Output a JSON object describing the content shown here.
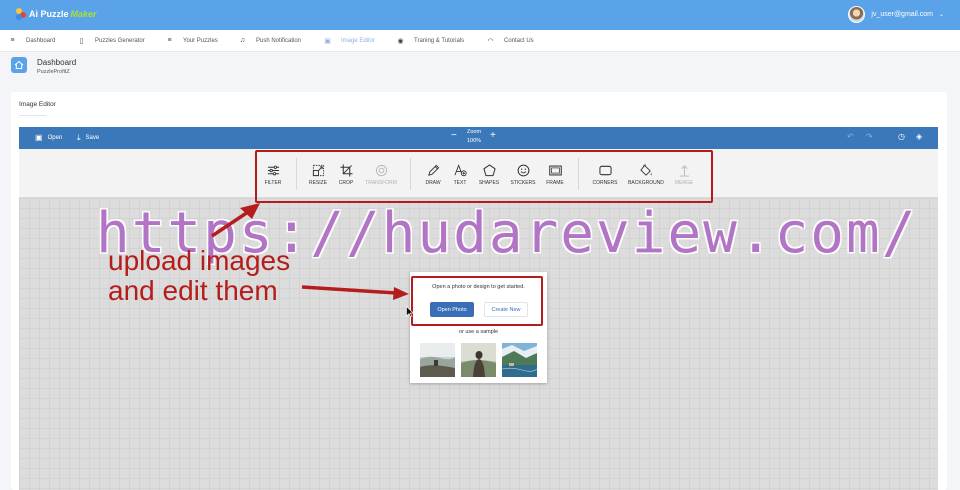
{
  "header": {
    "logo_text": "Ai Puzzle",
    "logo_accent": "Maker",
    "user_email": "jv_user@gmail.com",
    "caret": "⌄"
  },
  "nav": {
    "items": [
      {
        "label": "Dashboard",
        "icon": "menu-icon",
        "glyph": "≡"
      },
      {
        "label": "Puzzles Generator",
        "icon": "tablet-icon",
        "glyph": "▯"
      },
      {
        "label": "Your Puzzles",
        "icon": "list-icon",
        "glyph": "≡"
      },
      {
        "label": "Push Notification",
        "icon": "bell-icon",
        "glyph": "♫"
      },
      {
        "label": "Image Editor",
        "icon": "image-icon",
        "glyph": "▣",
        "active": true
      },
      {
        "label": "Traning & Tutorials",
        "icon": "play-circle-icon",
        "glyph": "◉"
      },
      {
        "label": "Contact Us",
        "icon": "headset-icon",
        "glyph": "◠"
      }
    ]
  },
  "breadcrumb": {
    "title": "Dashboard",
    "subtitle": "PuzzleProfitZ"
  },
  "card": {
    "title": "Image Editor"
  },
  "editor": {
    "open_label": "Open",
    "save_label": "Save",
    "zoom_label": "Zoom",
    "zoom_value": "100%",
    "zoom_minus": "−",
    "zoom_plus": "+",
    "tools": [
      {
        "label": "FILTER",
        "icon": "filter-sliders-icon"
      },
      {
        "label": "RESIZE",
        "icon": "resize-icon"
      },
      {
        "label": "CROP",
        "icon": "crop-icon"
      },
      {
        "label": "TRANSFORM",
        "icon": "transform-icon",
        "disabled": true
      },
      {
        "label": "DRAW",
        "icon": "pencil-icon"
      },
      {
        "label": "TEXT",
        "icon": "text-icon"
      },
      {
        "label": "SHAPES",
        "icon": "pentagon-icon"
      },
      {
        "label": "STICKERS",
        "icon": "smiley-icon"
      },
      {
        "label": "FRAME",
        "icon": "frame-icon"
      },
      {
        "label": "CORNERS",
        "icon": "rounded-rect-icon"
      },
      {
        "label": "BACKGROUND",
        "icon": "paint-bucket-icon"
      },
      {
        "label": "MERGE",
        "icon": "merge-icon",
        "disabled": true
      }
    ]
  },
  "start_panel": {
    "message": "Open a photo or design to get started.",
    "open_photo": "Open Photo",
    "create_new": "Create New",
    "sample_label": "or use a sample"
  },
  "overlay": {
    "watermark": "https://hudareview.com/",
    "annotation_line1": "upload images",
    "annotation_line2": "and edit them"
  },
  "colors": {
    "header_blue": "#5ba3e8",
    "editor_blue": "#3a78b9",
    "annotation_red": "#b51d1d",
    "watermark_purple": "#b06fc4"
  }
}
